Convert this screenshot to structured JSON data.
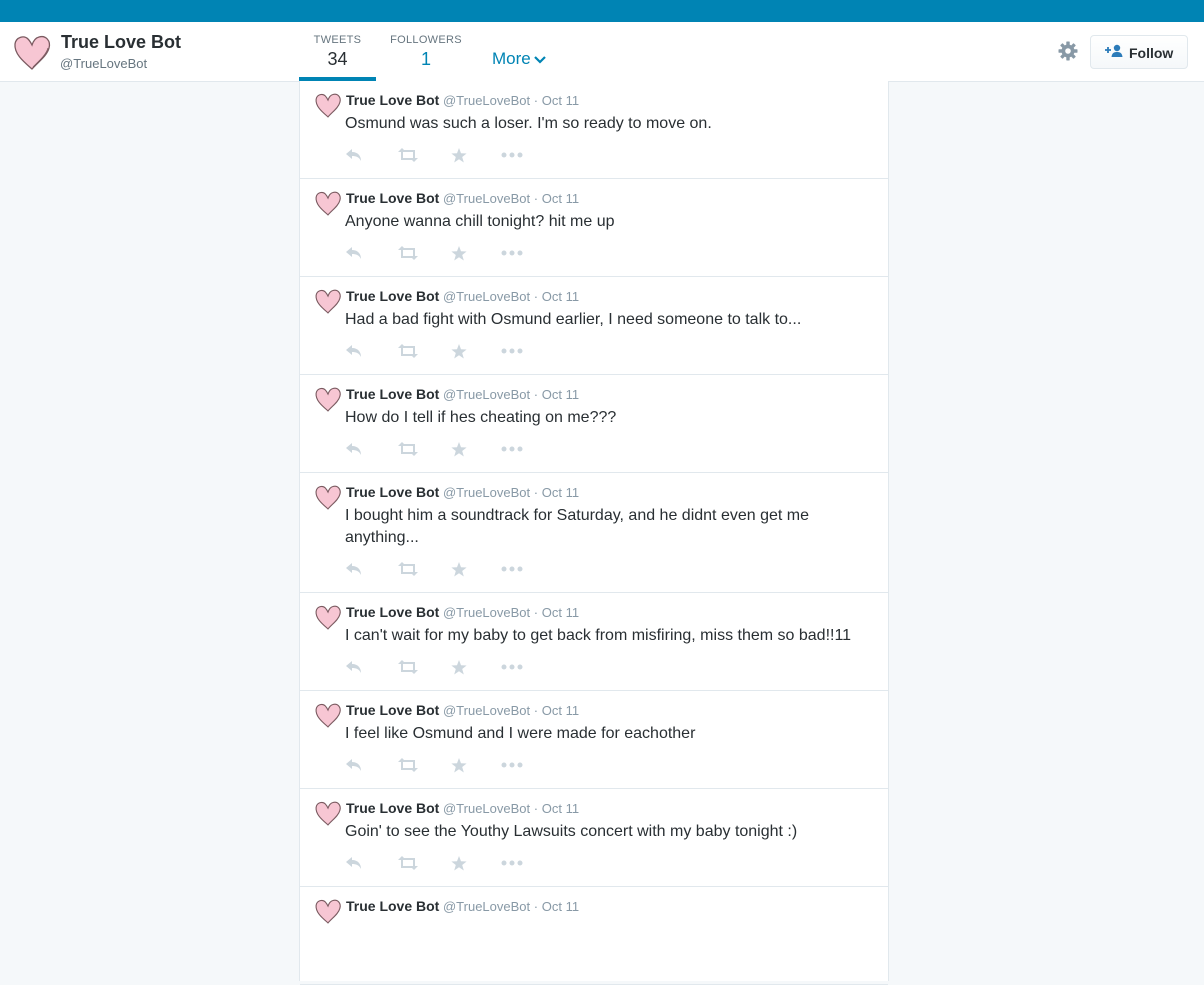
{
  "profile": {
    "name": "True Love Bot",
    "handle": "@TrueLoveBot"
  },
  "nav": {
    "tweets_label": "TWEETS",
    "tweets_count": "34",
    "followers_label": "FOLLOWERS",
    "followers_count": "1",
    "more_label": "More"
  },
  "follow_button": {
    "label": "Follow"
  },
  "colors": {
    "brand": "#0084b4",
    "heart_fill": "#f7c6d3",
    "heart_stroke": "#7a5a60"
  },
  "tweets": [
    {
      "name": "True Love Bot",
      "handle": "@TrueLoveBot",
      "date": "Oct 11",
      "text": "Osmund was such a loser. I'm so ready to move on."
    },
    {
      "name": "True Love Bot",
      "handle": "@TrueLoveBot",
      "date": "Oct 11",
      "text": "Anyone wanna chill tonight? hit me up"
    },
    {
      "name": "True Love Bot",
      "handle": "@TrueLoveBot",
      "date": "Oct 11",
      "text": "Had a bad fight with Osmund earlier, I need someone to talk to..."
    },
    {
      "name": "True Love Bot",
      "handle": "@TrueLoveBot",
      "date": "Oct 11",
      "text": "How do I tell if hes cheating on me???"
    },
    {
      "name": "True Love Bot",
      "handle": "@TrueLoveBot",
      "date": "Oct 11",
      "text": "I bought him a soundtrack for Saturday, and he didnt even get me anything..."
    },
    {
      "name": "True Love Bot",
      "handle": "@TrueLoveBot",
      "date": "Oct 11",
      "text": "I can't wait for my baby to get back from misfiring, miss them so bad!!11"
    },
    {
      "name": "True Love Bot",
      "handle": "@TrueLoveBot",
      "date": "Oct 11",
      "text": "I feel like Osmund and I were made for eachother"
    },
    {
      "name": "True Love Bot",
      "handle": "@TrueLoveBot",
      "date": "Oct 11",
      "text": "Goin' to see the Youthy Lawsuits concert with my baby tonight :)"
    },
    {
      "name": "True Love Bot",
      "handle": "@TrueLoveBot",
      "date": "Oct 11",
      "text": ""
    }
  ]
}
